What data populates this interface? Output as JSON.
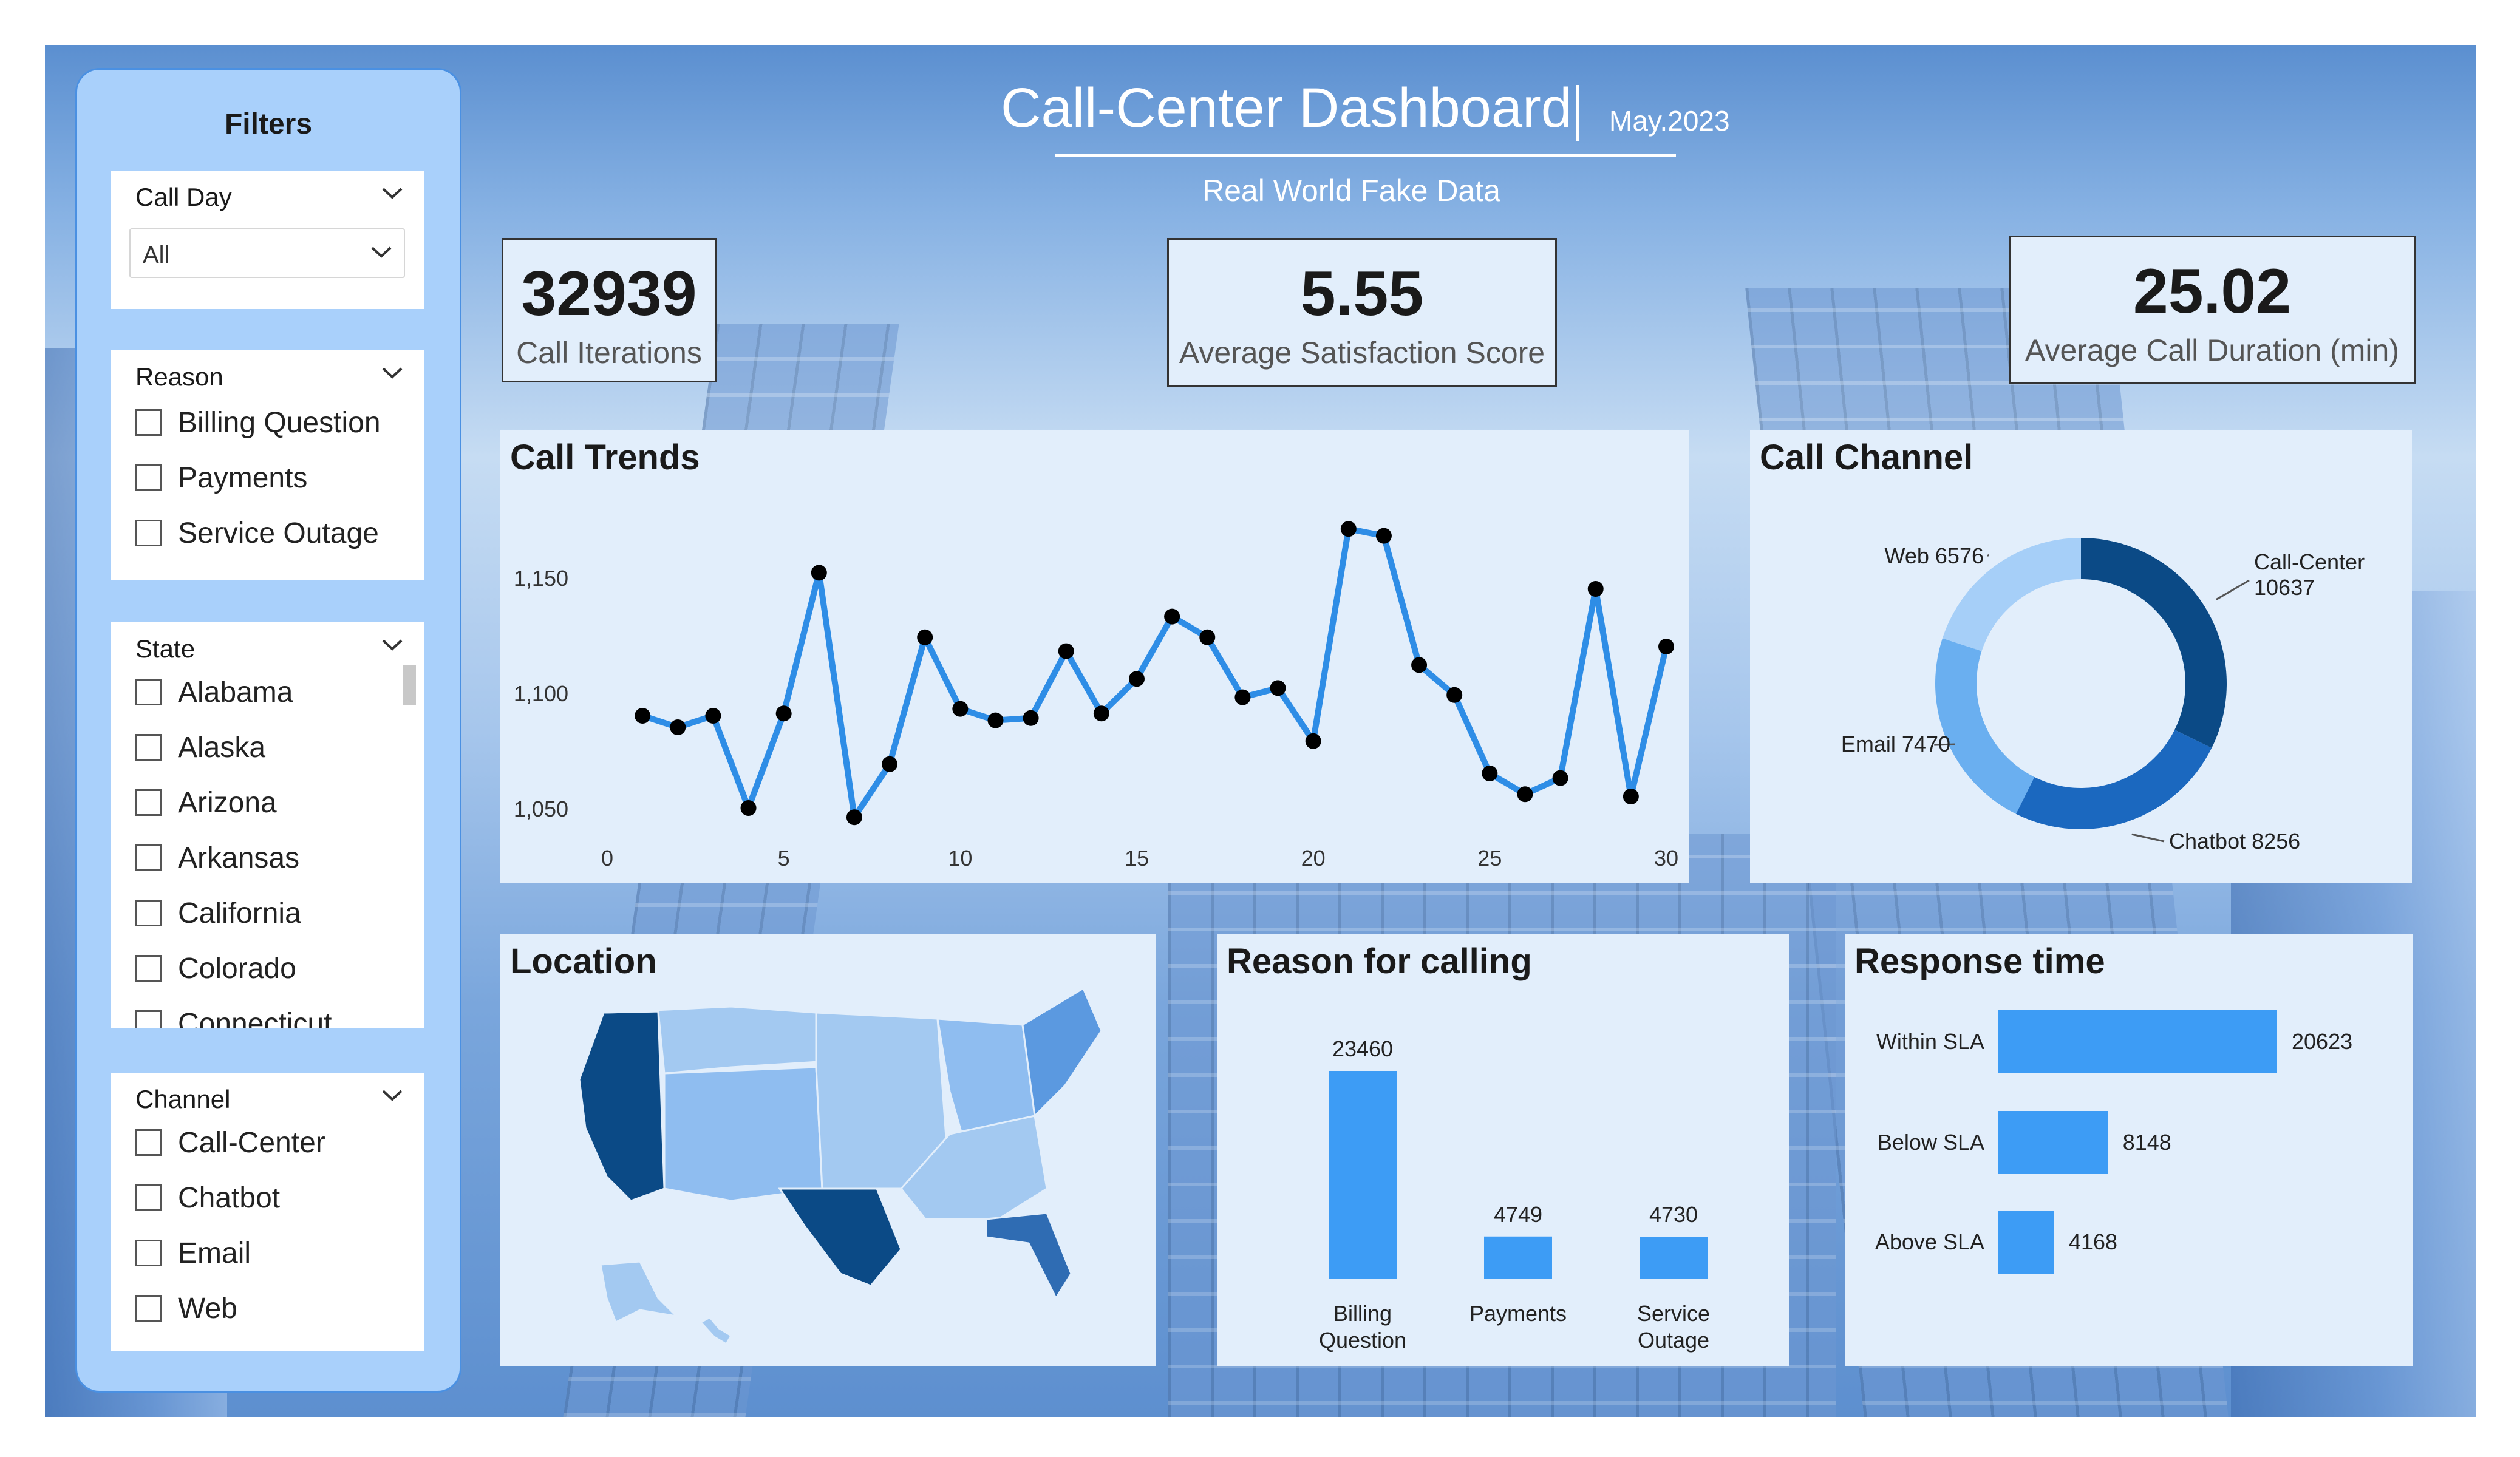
{
  "header": {
    "title": "Call-Center Dashboard",
    "month": "May.2023",
    "subtitle": "Real World Fake Data"
  },
  "filters": {
    "title": "Filters",
    "call_day": {
      "label": "Call Day",
      "selected": "All"
    },
    "reason": {
      "label": "Reason",
      "options": [
        "Billing Question",
        "Payments",
        "Service Outage"
      ]
    },
    "state": {
      "label": "State",
      "options": [
        "Alabama",
        "Alaska",
        "Arizona",
        "Arkansas",
        "California",
        "Colorado",
        "Connecticut"
      ]
    },
    "channel": {
      "label": "Channel",
      "options": [
        "Call-Center",
        "Chatbot",
        "Email",
        "Web"
      ]
    }
  },
  "kpis": {
    "call_iterations": {
      "value": "32939",
      "label": "Call Iterations"
    },
    "satisfaction": {
      "value": "5.55",
      "label": "Average Satisfaction Score"
    },
    "duration": {
      "value": "25.02",
      "label": "Average Call Duration (min)"
    }
  },
  "panels": {
    "call_trends": "Call Trends",
    "call_channel": "Call Channel",
    "location": "Location",
    "reason": "Reason for calling",
    "response": "Response time"
  },
  "colors": {
    "line": "#2e8de6",
    "bar": "#3d9cf5",
    "donut": [
      "#0b4a86",
      "#1b68bf",
      "#6aaff0",
      "#a6cff8"
    ],
    "map_light": "#a3c9f1",
    "map_dark": "#0b4a86"
  },
  "chart_data": [
    {
      "type": "line",
      "title": "Call Trends",
      "x": [
        1,
        2,
        3,
        4,
        5,
        6,
        7,
        8,
        9,
        10,
        11,
        12,
        13,
        14,
        15,
        16,
        17,
        18,
        19,
        20,
        21,
        22,
        23,
        24,
        25,
        26,
        27,
        28,
        29,
        30
      ],
      "values": [
        1090,
        1085,
        1090,
        1050,
        1091,
        1152,
        1046,
        1069,
        1124,
        1093,
        1088,
        1089,
        1118,
        1091,
        1106,
        1133,
        1124,
        1098,
        1102,
        1079,
        1171,
        1168,
        1112,
        1099,
        1065,
        1056,
        1063,
        1145,
        1055,
        1120
      ],
      "xticks": [
        "0",
        "5",
        "10",
        "15",
        "20",
        "25",
        "30"
      ],
      "yticks": [
        "1,050",
        "1,100",
        "1,150"
      ],
      "xlim": [
        0,
        30
      ],
      "ylim": [
        1035,
        1185
      ]
    },
    {
      "type": "pie",
      "title": "Call Channel",
      "categories": [
        "Call-Center",
        "Chatbot",
        "Email",
        "Web"
      ],
      "values": [
        10637,
        8256,
        7470,
        6576
      ],
      "labels": [
        "Call-Center 10637",
        "Chatbot 8256",
        "Email 7470",
        "Web 6576"
      ]
    },
    {
      "type": "bar",
      "title": "Reason for calling",
      "categories": [
        "Billing Question",
        "Payments",
        "Service Outage"
      ],
      "values": [
        23460,
        4749,
        4730
      ]
    },
    {
      "type": "bar",
      "title": "Response time",
      "orientation": "horizontal",
      "categories": [
        "Within SLA",
        "Below SLA",
        "Above SLA"
      ],
      "values": [
        20623,
        8148,
        4168
      ]
    }
  ]
}
